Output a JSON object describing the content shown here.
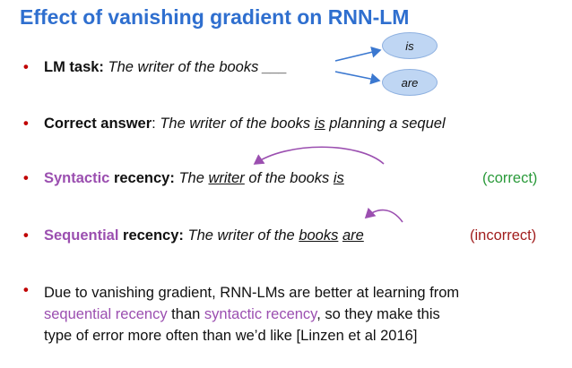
{
  "title": "Effect of vanishing gradient on RNN-LM",
  "bubbles": {
    "is": "is",
    "are": "are"
  },
  "b1": {
    "label": "LM task:",
    "text": "The writer of the books ___"
  },
  "b2": {
    "label": "Correct answer",
    "colon": ":",
    "pre": "The writer of the books ",
    "u": "is",
    "post": " planning a sequel"
  },
  "b3": {
    "label_colored": "Syntactic",
    "label_rest": " recency:",
    "pre": "The ",
    "u1": "writer",
    "mid": " of the books ",
    "u2": "is",
    "tag": "(correct)"
  },
  "b4": {
    "label_colored": "Sequential",
    "label_rest": " recency:",
    "pre": "The writer of the ",
    "u1": "books",
    "space": " ",
    "u2": "are",
    "tag": "(incorrect)"
  },
  "b5": {
    "p1": "Due to vanishing gradient, RNN-LMs are better at learning from",
    "p2a": "sequential recency",
    "p2b": " than ",
    "p2c": "syntactic recency",
    "p2d": ", so they make this",
    "p3": "type of error more often than we’d like [Linzen et al 2016]"
  },
  "colors": {
    "title": "#2f6fcf",
    "bullet": "#c00000",
    "purple": "#9b4fb0",
    "green": "#2a9a3a",
    "red": "#a11d1d",
    "bubble": "#bfd6f3"
  }
}
